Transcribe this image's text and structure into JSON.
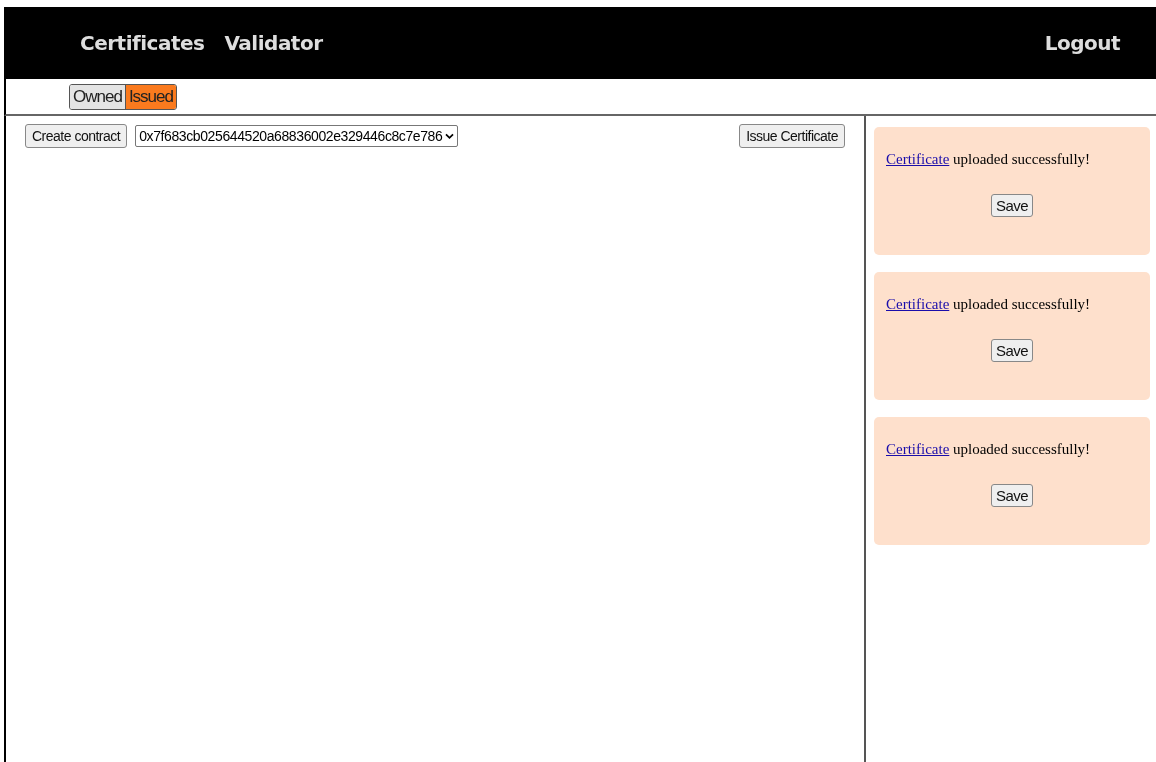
{
  "header": {
    "links": [
      "Certificates",
      "Validator"
    ],
    "logout": "Logout"
  },
  "tabs": [
    {
      "label": "Owned",
      "selected": false
    },
    {
      "label": "Issued",
      "selected": true
    }
  ],
  "toolbar": {
    "create_button": "Create contract",
    "contract_select": "0x7f683cb025644520a68836002e329446c8c7e786",
    "issue_button": "Issue Certificate"
  },
  "notifications": [
    {
      "link": "Certificate",
      "message": "uploaded successfully!",
      "button": "Save"
    },
    {
      "link": "Certificate",
      "message": "uploaded successfully!",
      "button": "Save"
    },
    {
      "link": "Certificate",
      "message": "uploaded successfully!",
      "button": "Save"
    }
  ]
}
